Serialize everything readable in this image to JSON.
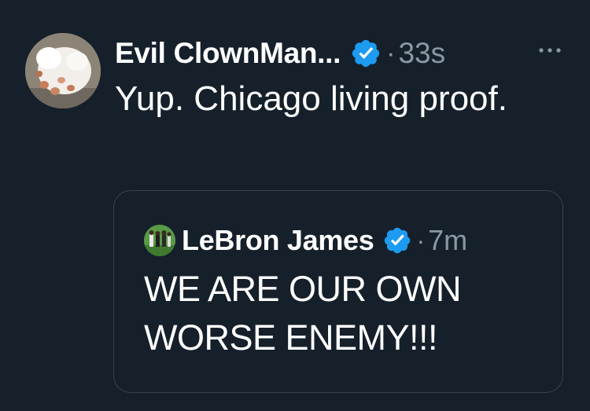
{
  "tweet": {
    "author": {
      "display_name": "Evil ClownMan...",
      "avatar_icon": "dog-paw-avatar",
      "verified": true
    },
    "separator": "·",
    "time": "33s",
    "more_icon": "more-horizontal-icon",
    "text": "Yup. Chicago living proof."
  },
  "quoted_tweet": {
    "author": {
      "display_name": "LeBron James",
      "avatar_icon": "lebron-avatar",
      "verified": true
    },
    "separator": "·",
    "time": "7m",
    "text": "WE ARE OUR OWN WORSE ENEMY!!!"
  },
  "colors": {
    "background": "#15202b",
    "text_primary": "#ffffff",
    "text_secondary": "#8b98a5",
    "verified_badge": "#1d9bf0",
    "border": "#38444d"
  }
}
